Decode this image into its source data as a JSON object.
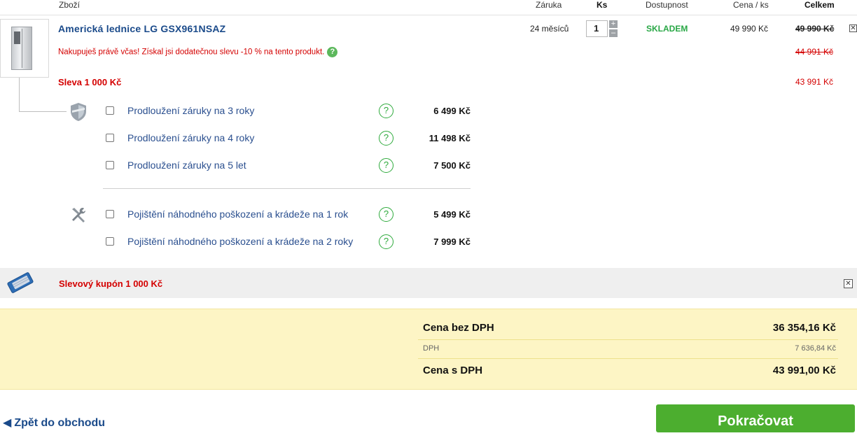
{
  "header": {
    "col_item": "Zboží",
    "col_warranty": "Záruka",
    "col_qty": "Ks",
    "col_availability": "Dostupnost",
    "col_unit_price": "Cena / ks",
    "col_total": "Celkem"
  },
  "product": {
    "name": "Americká lednice  LG GSX961NSAZ",
    "warranty": "24 měsíců",
    "quantity": "1",
    "availability": "SKLADEM",
    "unit_price": "49 990 Kč",
    "total_original": "49 990 Kč",
    "promo_text": "Nakupuješ právě včas! Získal jsi dodatečnou slevu -10 % na tento produkt.",
    "promo_help": "?",
    "total_after_promo": "44 991 Kč",
    "discount_label": "Sleva 1 000 Kč",
    "total_after_discount": "43 991 Kč"
  },
  "warranty_options": [
    {
      "label": "Prodloužení záruky na 3 roky",
      "price": "6 499 Kč"
    },
    {
      "label": "Prodloužení záruky na 4 roky",
      "price": "11 498 Kč"
    },
    {
      "label": "Prodloužení záruky na 5 let",
      "price": "7 500 Kč"
    }
  ],
  "insurance_options": [
    {
      "label": "Pojištění náhodného poškození a krádeže na 1 rok",
      "price": "5 499 Kč"
    },
    {
      "label": "Pojištění náhodného poškození a krádeže na 2 roky",
      "price": "7 999 Kč"
    }
  ],
  "coupon": {
    "label": "Slevový kupón 1 000 Kč"
  },
  "totals": {
    "without_vat_label": "Cena bez DPH",
    "without_vat_value": "36 354,16 Kč",
    "vat_label": "DPH",
    "vat_value": "7 636,84 Kč",
    "with_vat_label": "Cena s DPH",
    "with_vat_value": "43 991,00 Kč"
  },
  "footer": {
    "back_link": "Zpět do obchodu",
    "continue_button": "Pokračovat"
  },
  "icons": {
    "help": "question-circle-icon",
    "shield": "shield-icon",
    "tools": "wrench-screwdriver-icon",
    "coupon": "ticket-icon",
    "close": "close-icon"
  },
  "colors": {
    "brand_blue": "#1a4a8a",
    "red": "#d40000",
    "green": "#28a745",
    "totals_bg": "#fdf5c5",
    "button_green": "#4cae2f"
  }
}
